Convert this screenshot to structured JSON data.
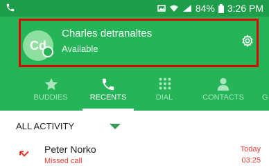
{
  "status_bar": {
    "battery": "84%",
    "time": "3:26 PM",
    "icons": [
      "phone-call-icon",
      "image-icon",
      "wifi-icon",
      "signal-icon",
      "battery-icon"
    ]
  },
  "profile": {
    "initials": "Cd",
    "name": "Charles detranaltes",
    "presence": "Available",
    "settings_icon": "gear-icon"
  },
  "tabs": [
    {
      "label": "BUDDIES",
      "icon": "star-icon",
      "active": false
    },
    {
      "label": "RECENTS",
      "icon": "phone-icon",
      "active": true
    },
    {
      "label": "DIAL",
      "icon": "dialpad-icon",
      "active": false
    },
    {
      "label": "CONTACTS",
      "icon": "person-icon",
      "active": false
    },
    {
      "label": "G",
      "icon": "group-icon",
      "active": false
    }
  ],
  "filter": {
    "label": "ALL ACTIVITY"
  },
  "recents": [
    {
      "name": "Peter Norko",
      "type": "Missed call",
      "date": "Today",
      "time": "03:25",
      "icon": "missed-call-icon"
    }
  ],
  "colors": {
    "header": "#25b457",
    "status_bar": "#1e9e4a",
    "missed": "#e53935",
    "highlight": "#e00000"
  }
}
